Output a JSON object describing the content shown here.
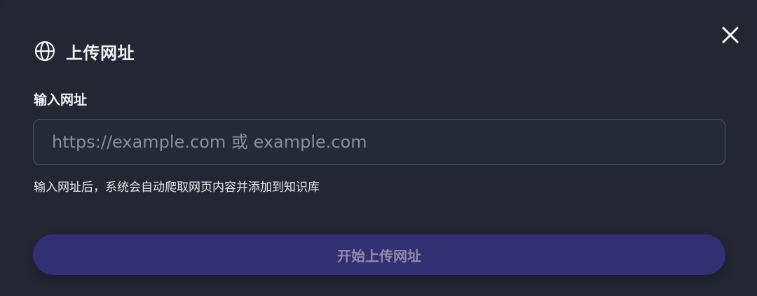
{
  "dialog": {
    "title": "上传网址",
    "title_icon": "globe-icon",
    "close_icon": "close-icon"
  },
  "form": {
    "label": "输入网址",
    "input_value": "",
    "placeholder": "https://example.com 或 example.com",
    "helper": "输入网址后，系统会自动爬取网页内容并添加到知识库"
  },
  "submit": {
    "label": "开始上传网址",
    "state": "disabled"
  },
  "colors": {
    "background": "#242634",
    "input_border": "#4b4f5f",
    "button_bg": "#332f73",
    "button_text": "#8f8ca8",
    "text": "#f2f3f7"
  }
}
